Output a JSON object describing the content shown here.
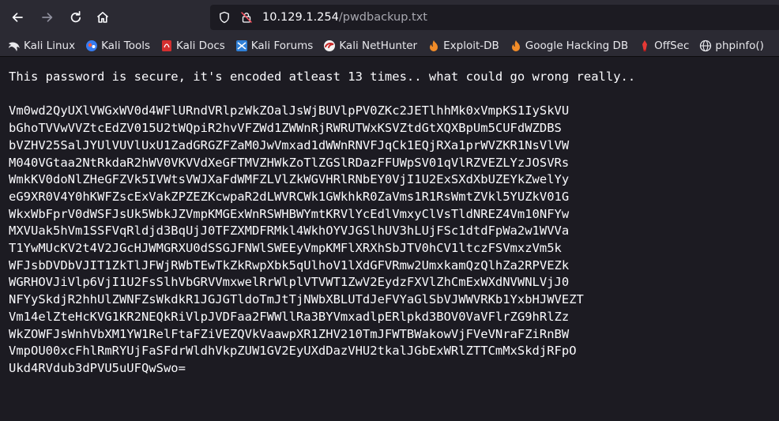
{
  "browser": {
    "url_host": "10.129.1.254",
    "url_path": "/pwdbackup.txt"
  },
  "bookmarks": [
    {
      "label": "Kali Linux",
      "icon": "kali-dragon-icon"
    },
    {
      "label": "Kali Tools",
      "icon": "kali-tools-icon"
    },
    {
      "label": "Kali Docs",
      "icon": "kali-docs-icon"
    },
    {
      "label": "Kali Forums",
      "icon": "kali-forums-icon"
    },
    {
      "label": "Kali NetHunter",
      "icon": "kali-nethunter-icon"
    },
    {
      "label": "Exploit-DB",
      "icon": "exploit-db-icon"
    },
    {
      "label": "Google Hacking DB",
      "icon": "ghdb-icon"
    },
    {
      "label": "OffSec",
      "icon": "offsec-icon"
    },
    {
      "label": "phpinfo()",
      "icon": "globe-icon"
    }
  ],
  "page": {
    "message": "This password is secure, it's encoded atleast 13 times.. what could go wrong really..",
    "encoded_lines": [
      "Vm0wd2QyUXlVWGxWV0d4WFlURndVRlpzWkZOalJsWjBUVlpPV0ZKc2JETlhhMk0xVmpKS1IySkVU",
      "bGhoTVVwVVZtcEdZV015U2tWQpiR2hvVFZWd1ZWWnRjRWRUTWxKSVZtdGtXQXBpUm5CUFdWZDBS",
      "bVZHV25SalJYUlVUVlUxU1ZadGRGZFZaM0JwVmxad1dWWnRNVFJqCk1EQjRXa1prWVZKR1NsVlVW",
      "M040VGtaa2NtRkdaR2hWV0VKVVdXeGFTMVZHWkZoTlZGSlRDazFFUWpSV01qVlRZVEZLYzJOSVRs",
      "WmkKV0doNlZHeGFZVk5IVWtsVWJXaFdWMFZLVlZkWGVHRlRNbEY0VjI1U2ExSXdXbUZEYkZwelYy",
      "eG9XR0V4Y0hKWFZscExVakZPZEZKcwpaR2dLWVRCWk1GWkhkR0ZaVms1R1RsWmtZVkl5YUZkV01G",
      "WkxWbFprV0dWSFJsUk5WbkJZVmpKMGExWnRSWHBWYmtKRVlYcEdlVmxyClVsTldNREZ4Vm10NFYw",
      "MXVUak5hVm1SSFVqRldjd3BqUjJ0TFZXMDFRMkl4WkhOYVJGSlhUV3hLUjFSc1dtdFpWa2w1WVVa",
      "T1YwMUcKV2t4V2JGcHJWMGRXU0dSSGJFNWlSWEEyVmpKMFlXRXhSbJTV0hCV1ltczFSVmxzVm5k",
      "WFJsbDVDbVJIT1ZkTlJFWjRWbTEwTkZkRwpXbk5qUlhoV1lXdGFVRmw2UmxkamQzQlhZa2RPVEZk",
      "WGRHOVJiVlp6VjI1U2FsSlhVbGRVVmxwelRrWlplVTVWT1ZwV2EydzFXVlZhCmExWXdNVWNLVjJ0",
      "NFYySkdjR2hhUlZWNFZsWkdkR1JGJGTldoTmJtTjNWbXBLUTdJeFVYaGlSbVJWWVRKb1YxbHJWVEZT",
      "Vm14elZteHcKVG1KR2NEQkRiVlpJVDFaa2FWWllRa3BYVmxadlpERlpkd3BOV0VaVFlrZG9hRlZz",
      "WkZOWFJsWnhVbXM1YW1RelFtaFZiVEZQVkVaawpXR1ZHV210TmJFWTBWakowVjFVeVNraFZiRnBW",
      "VmpOU00xcFhlRmRYUjFaSFdrWldhVkpZUW1GV2EyUXdDazVHU2tkalJGbExWRlZTTCmMxSkdjRFpO",
      "Ukd4RVdub3dPVU5uUFQwSwo="
    ]
  }
}
